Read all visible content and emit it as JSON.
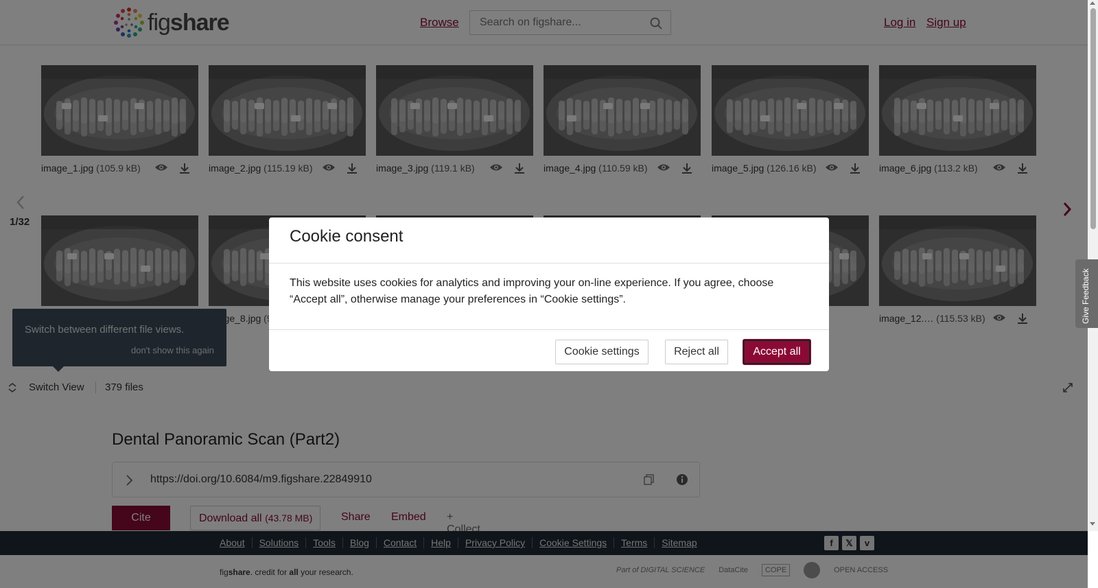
{
  "header": {
    "logo_text_a": "fig",
    "logo_text_b": "share",
    "browse": "Browse",
    "search_placeholder": "Search on figshare...",
    "login": "Log in",
    "signup": "Sign up"
  },
  "viewer": {
    "pager": "1/32",
    "tiles": [
      {
        "name": "image_1.jpg",
        "size": "(105.9 kB)"
      },
      {
        "name": "image_2.jpg",
        "size": "(115.19 kB)"
      },
      {
        "name": "image_3.jpg",
        "size": "(119.1 kB)"
      },
      {
        "name": "image_4.jpg",
        "size": "(110.59 kB)"
      },
      {
        "name": "image_5.jpg",
        "size": "(126.16 kB)"
      },
      {
        "name": "image_6.jpg",
        "size": "(113.2 kB)"
      },
      {
        "name": "",
        "size": ""
      },
      {
        "name": "image_8.jpg",
        "size": "(9"
      },
      {
        "name": "",
        "size": ""
      },
      {
        "name": "",
        "size": ""
      },
      {
        "name": "",
        "size": ""
      },
      {
        "name": "image_12.…",
        "size": "(115.53 kB)"
      }
    ],
    "switch_view": "Switch View",
    "file_count": "379 files",
    "tooltip_text": "Switch between different file views.",
    "tooltip_dismiss": "don't show this again"
  },
  "item": {
    "title": "Dental Panoramic Scan (Part2)",
    "doi": "https://doi.org/10.6084/m9.figshare.22849910",
    "cite": "Cite",
    "download_all": "Download all",
    "download_size": "(43.78 MB)",
    "share": "Share",
    "embed": "Embed",
    "collect": "+ Collect"
  },
  "footer": {
    "links": [
      "About",
      "Solutions",
      "Tools",
      "Blog",
      "Contact",
      "Help",
      "Privacy Policy",
      "Cookie Settings",
      "Terms",
      "Sitemap"
    ],
    "credit_a": "fig",
    "credit_b": "share",
    "credit_c": ". credit for ",
    "credit_d": "all",
    "credit_e": " your research.",
    "partner_1": "Part of DIGITAL SCIENCE",
    "partner_2": "DataCite",
    "partner_3": "COPE",
    "partner_4": "",
    "partner_5": "OPEN ACCESS",
    "social": [
      "f",
      "𝕏",
      "v"
    ]
  },
  "feedback": "Give Feedback",
  "modal": {
    "title": "Cookie consent",
    "body": "This website uses cookies for analytics and improving your on-line experience. If you agree, choose “Accept all”, otherwise manage your preferences in “Cookie settings”.",
    "settings": "Cookie settings",
    "reject": "Reject all",
    "accept": "Accept all"
  },
  "colors": {
    "brand": "#8b0a35",
    "footer_bg": "#1f2b34"
  }
}
